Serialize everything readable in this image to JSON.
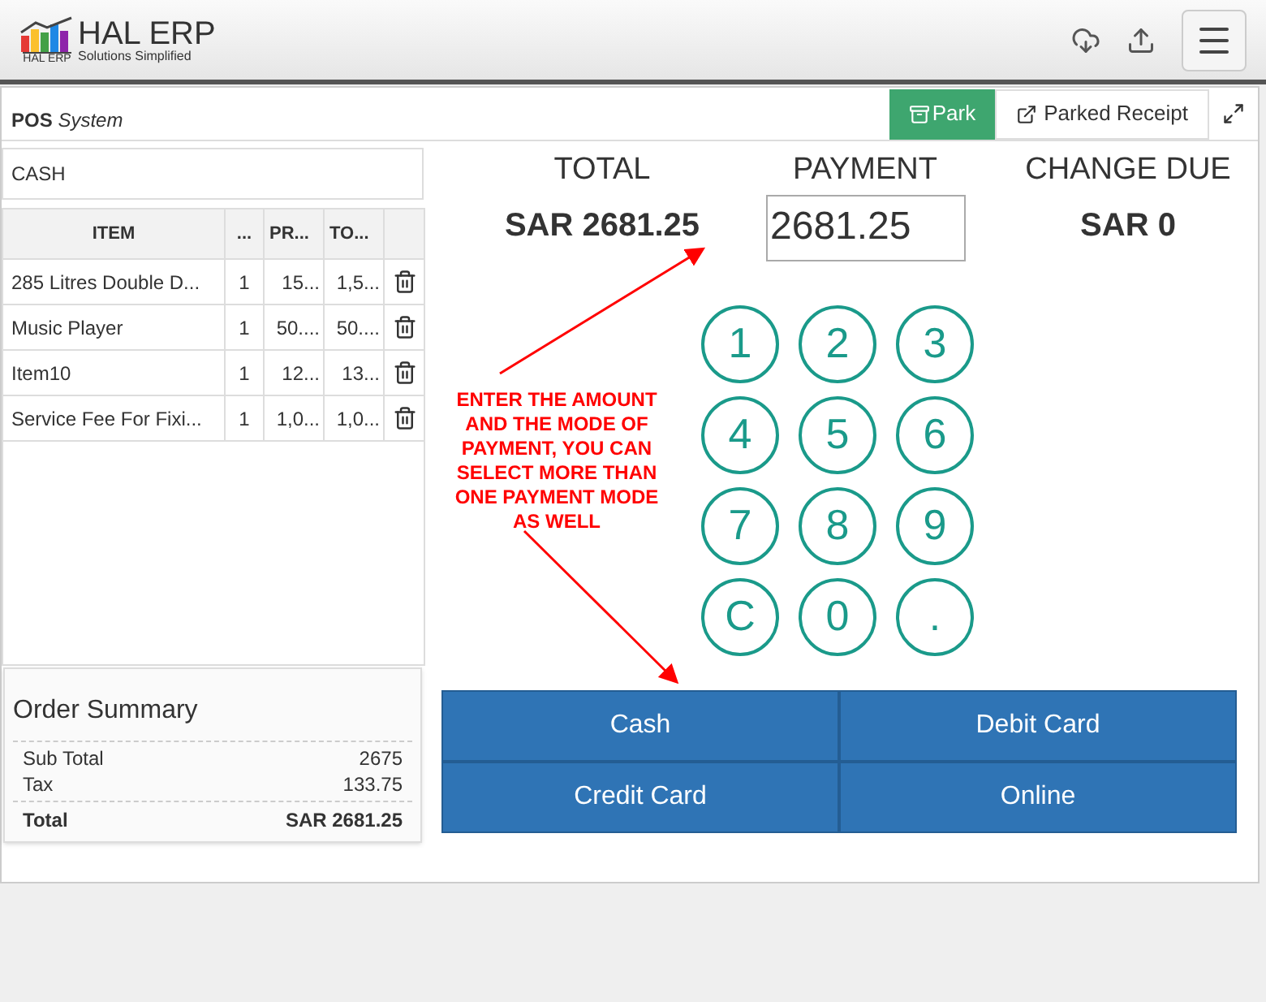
{
  "header": {
    "logo_badge": "HAL ERP",
    "brand": "HAL ERP",
    "tagline": "Solutions Simplified"
  },
  "title": {
    "bold": "POS",
    "italic": "System"
  },
  "actions": {
    "park": "Park",
    "parked_receipt": "Parked Receipt"
  },
  "customer": {
    "value": "CASH"
  },
  "table": {
    "columns": [
      "ITEM",
      "...",
      "PR...",
      "TO..."
    ],
    "rows": [
      [
        "285 Litres Double D...",
        "1",
        "15...",
        "1,5..."
      ],
      [
        "Music Player",
        "1",
        "50....",
        "50...."
      ],
      [
        "Item10",
        "1",
        "12...",
        "13..."
      ],
      [
        "Service Fee For Fixi...",
        "1",
        "1,0...",
        "1,0..."
      ]
    ]
  },
  "order_summary": {
    "title": "Order Summary",
    "lines": [
      {
        "label": "Sub Total",
        "value": "2675"
      },
      {
        "label": "Tax",
        "value": "133.75"
      }
    ],
    "total": {
      "label": "Total",
      "value": "SAR 2681.25"
    }
  },
  "totals": [
    {
      "label": "TOTAL",
      "value": "SAR 2681.25",
      "kind": "text"
    },
    {
      "label": "PAYMENT",
      "value": "2681.25",
      "kind": "input"
    },
    {
      "label": "CHANGE DUE",
      "value": "SAR 0",
      "kind": "text"
    }
  ],
  "keypad": [
    "1",
    "2",
    "3",
    "4",
    "5",
    "6",
    "7",
    "8",
    "9",
    "C",
    "0",
    "."
  ],
  "payment_modes": [
    "Cash",
    "Debit Card",
    "Credit Card",
    "Online"
  ],
  "annotation": "ENTER THE AMOUNT AND THE MODE OF PAYMENT, YOU CAN SELECT MORE THAN ONE PAYMENT MODE AS WELL"
}
